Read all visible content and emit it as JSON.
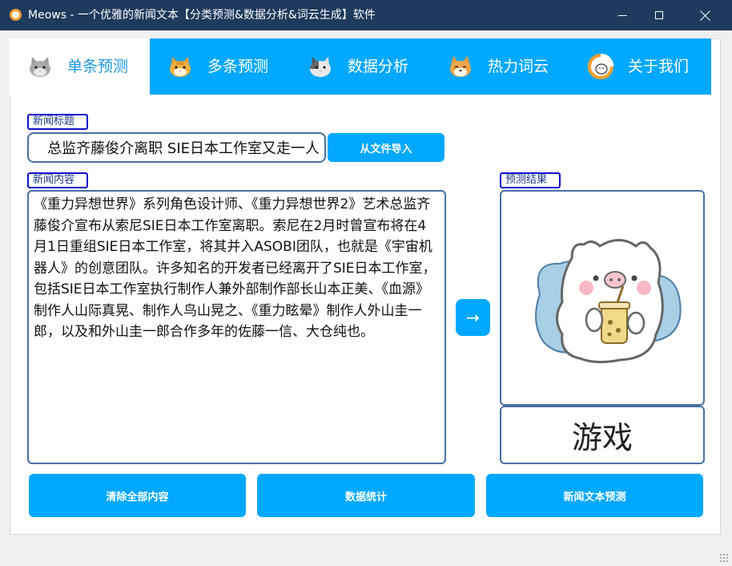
{
  "window": {
    "title": "Meows - 一个优雅的新闻文本【分类预测&数据分析&词云生成】软件"
  },
  "tabs": [
    {
      "label": "单条预测",
      "icon": "gray-cat-icon",
      "active": true
    },
    {
      "label": "多条预测",
      "icon": "tabby-cat-icon",
      "active": false
    },
    {
      "label": "数据分析",
      "icon": "calico-cat-icon",
      "active": false
    },
    {
      "label": "热力词云",
      "icon": "shiba-dog-icon",
      "active": false
    },
    {
      "label": "关于我们",
      "icon": "cat-logo-icon",
      "active": false
    }
  ],
  "form": {
    "title_label": "新闻标题",
    "title_value": "总监齐藤俊介离职 SIE日本工作室又走一人",
    "import_button": "从文件导入",
    "content_label": "新闻内容",
    "content_value": "《重力异想世界》系列角色设计师、《重力异想世界2》艺术总监齐藤俊介宣布从索尼SIE日本工作室离职。索尼在2月时曾宣布将在4月1日重组SIE日本工作室，将其并入ASOBI团队，也就是《宇宙机器人》的创意团队。许多知名的开发者已经离开了SIE日本工作室，包括SIE日本工作室执行制作人兼外部制作部长山本正美、《血源》制作人山际真晃、制作人鸟山晃之、《重力眩晕》制作人外山圭一郎，以及和外山圭一郎合作多年的佐藤一信、大仓纯也。",
    "arrow_button": "→",
    "result_label": "预测结果",
    "result_value": "游戏",
    "result_image": "cute-cat-with-drink-illustration"
  },
  "actions": {
    "clear": "清除全部内容",
    "stats": "数据统计",
    "predict": "新闻文本预测"
  },
  "colors": {
    "accent": "#00a8ff",
    "titlebar": "#1e3a5c",
    "label_border": "#1010cc",
    "textbox_border": "#4a6fa5"
  }
}
